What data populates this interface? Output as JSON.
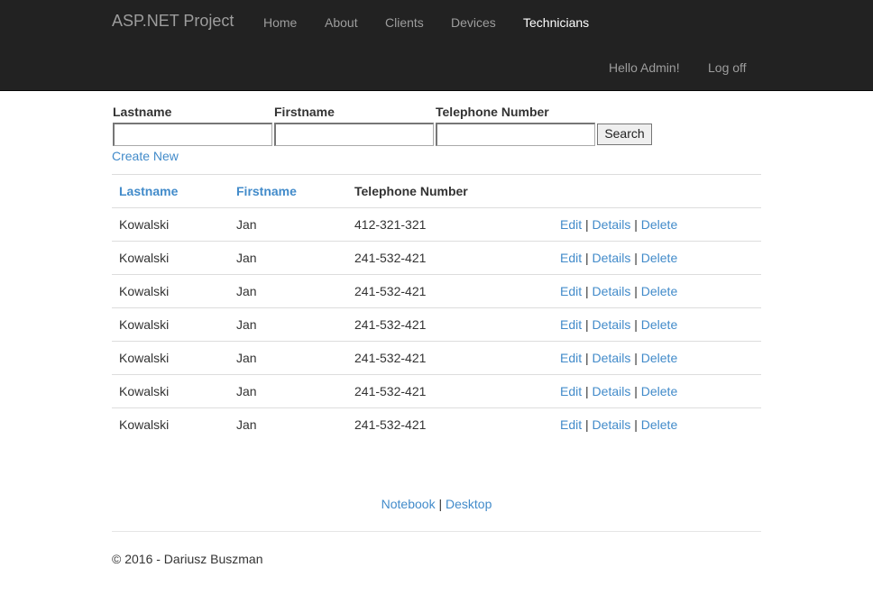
{
  "navbar": {
    "brand": "ASP.NET Project",
    "links": [
      "Home",
      "About",
      "Clients",
      "Devices",
      "Technicians"
    ],
    "active": "Technicians",
    "greeting": "Hello Admin!",
    "logoff": "Log off"
  },
  "search": {
    "lastname_label": "Lastname",
    "firstname_label": "Firstname",
    "phone_label": "Telephone Number",
    "lastname_value": "",
    "firstname_value": "",
    "phone_value": "",
    "button_label": "Search"
  },
  "create_new": "Create New",
  "table": {
    "headers": [
      "Lastname",
      "Firstname",
      "Telephone Number"
    ],
    "rows": [
      {
        "lastname": "Kowalski",
        "firstname": "Jan",
        "phone": "412-321-321"
      },
      {
        "lastname": "Kowalski",
        "firstname": "Jan",
        "phone": "241-532-421"
      },
      {
        "lastname": "Kowalski",
        "firstname": "Jan",
        "phone": "241-532-421"
      },
      {
        "lastname": "Kowalski",
        "firstname": "Jan",
        "phone": "241-532-421"
      },
      {
        "lastname": "Kowalski",
        "firstname": "Jan",
        "phone": "241-532-421"
      },
      {
        "lastname": "Kowalski",
        "firstname": "Jan",
        "phone": "241-532-421"
      },
      {
        "lastname": "Kowalski",
        "firstname": "Jan",
        "phone": "241-532-421"
      }
    ],
    "actions": {
      "edit": "Edit",
      "details": "Details",
      "delete": "Delete",
      "separator": "|"
    }
  },
  "footer": {
    "notebook": "Notebook",
    "desktop": "Desktop",
    "separator": "|",
    "copyright": "© 2016 - Dariusz Buszman"
  },
  "colors": {
    "navbar_bg": "#222222",
    "link": "#428bca",
    "nav_text": "#9d9d9d",
    "nav_active": "#ffffff"
  }
}
